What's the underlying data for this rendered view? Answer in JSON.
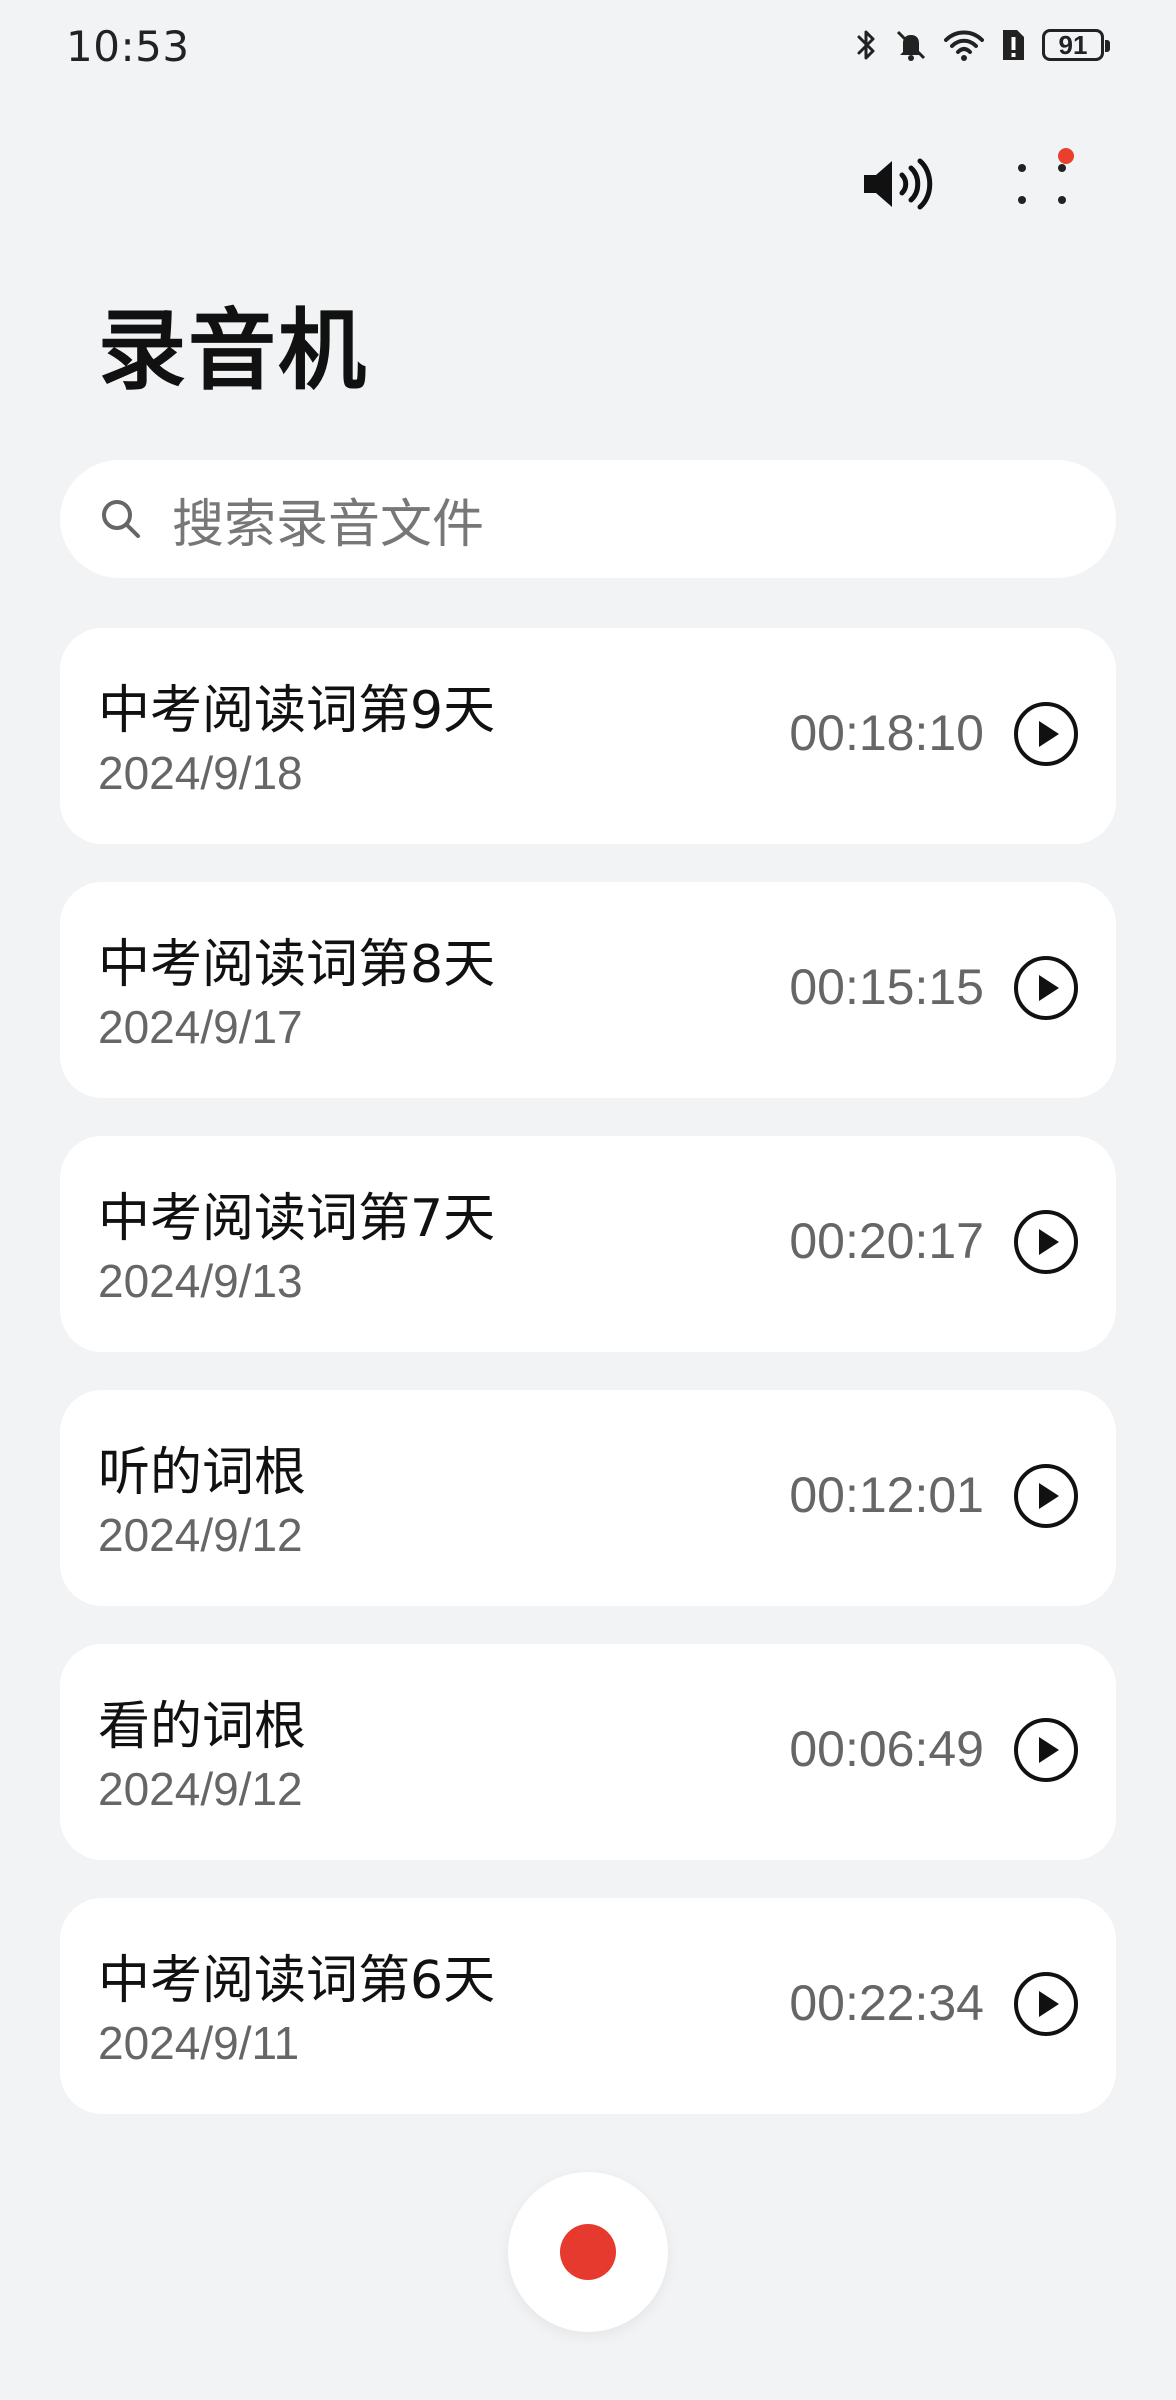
{
  "status_bar": {
    "time": "10:53",
    "battery": "91",
    "icons": [
      "bluetooth-icon",
      "mute-icon",
      "wifi-icon",
      "sim-alert-icon",
      "battery-icon"
    ]
  },
  "header": {
    "title": "录音机",
    "speaker_icon": "speaker-icon",
    "more_icon": "more-icon",
    "notification_dot_color": "#e8402c"
  },
  "search": {
    "placeholder": "搜索录音文件",
    "icon": "search-icon"
  },
  "recordings": [
    {
      "title": "中考阅读词第9天",
      "date": "2024/9/18",
      "duration": "00:18:10"
    },
    {
      "title": "中考阅读词第8天",
      "date": "2024/9/17",
      "duration": "00:15:15"
    },
    {
      "title": "中考阅读词第7天",
      "date": "2024/9/13",
      "duration": "00:20:17"
    },
    {
      "title": "听的词根",
      "date": "2024/9/12",
      "duration": "00:12:01"
    },
    {
      "title": "看的词根",
      "date": "2024/9/12",
      "duration": "00:06:49"
    },
    {
      "title": "中考阅读词第6天",
      "date": "2024/9/11",
      "duration": "00:22:34"
    }
  ],
  "record_button": {
    "icon": "record-icon",
    "color": "#e63a2e"
  }
}
